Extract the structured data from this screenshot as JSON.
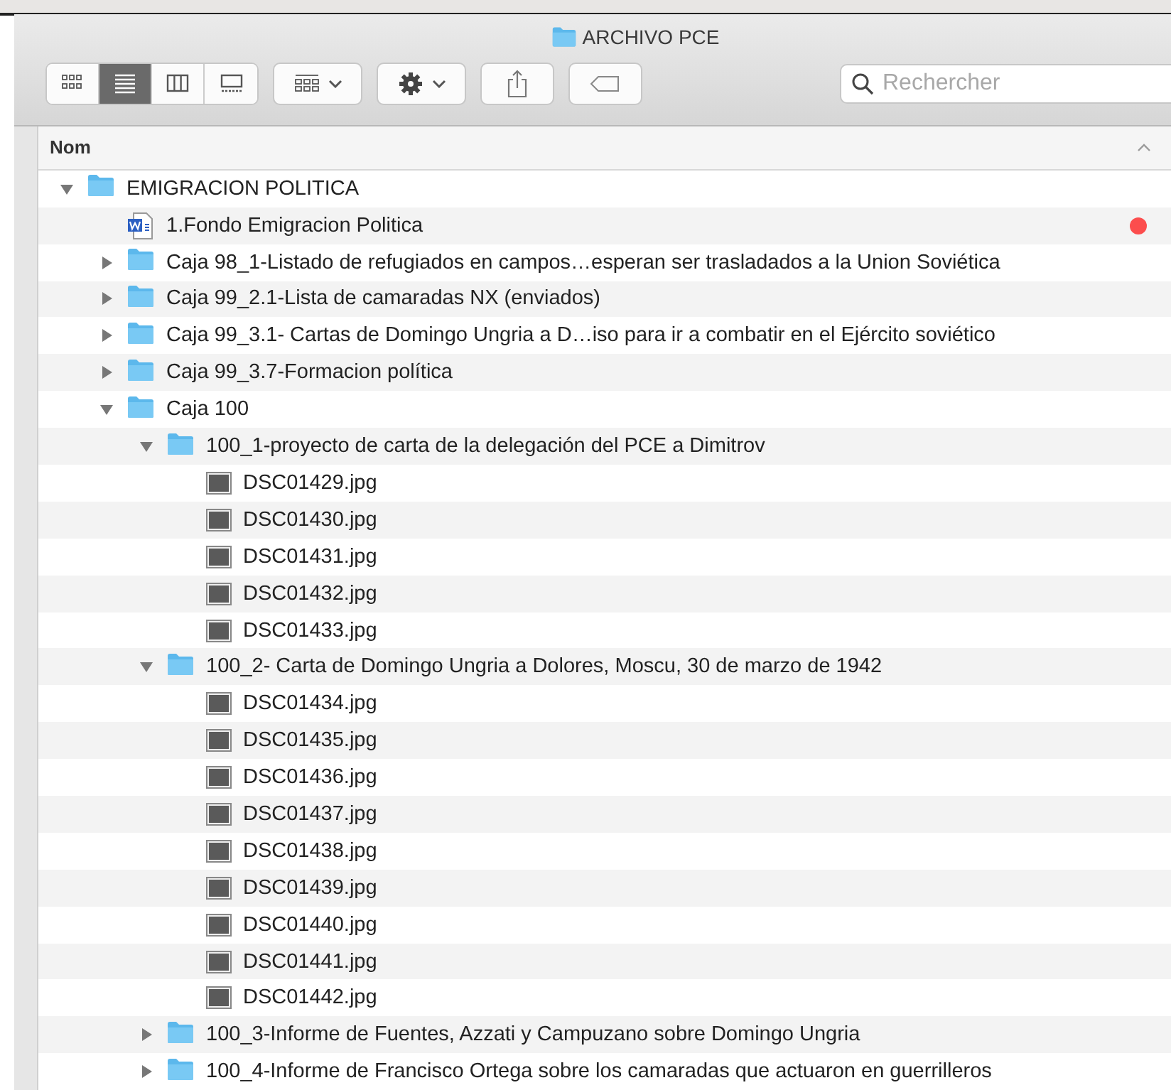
{
  "window": {
    "title": "ARCHIVO PCE"
  },
  "toolbar": {
    "view_modes": [
      {
        "kind": "icons",
        "selected": false
      },
      {
        "kind": "list",
        "selected": true
      },
      {
        "kind": "columns",
        "selected": false
      },
      {
        "kind": "gallery",
        "selected": false
      }
    ]
  },
  "search": {
    "placeholder": "Rechercher"
  },
  "table": {
    "columns": [
      "Nom"
    ],
    "rows": [
      {
        "kind": "folder",
        "name": "EMIGRACION POLITICA",
        "expanded": true,
        "children": [
          {
            "kind": "word",
            "name": "1.Fondo Emigracion Politica",
            "color": "#fc4d4d"
          },
          {
            "kind": "folder",
            "name": "Caja 98_1-Listado de refugiados en campos…esperan ser trasladados a la Union Soviética",
            "expanded": false
          },
          {
            "kind": "folder",
            "name": "Caja 99_2.1-Lista de camaradas NX (enviados)",
            "expanded": false
          },
          {
            "kind": "folder",
            "name": "Caja 99_3.1- Cartas de Domingo Ungria a D…iso para ir a combatir en el Ejército soviético",
            "expanded": false
          },
          {
            "kind": "folder",
            "name": "Caja 99_3.7-Formacion política",
            "expanded": false
          },
          {
            "kind": "folder",
            "name": "Caja 100",
            "expanded": true,
            "children": [
              {
                "kind": "folder",
                "name": "100_1-proyecto de carta de la delegación del PCE a Dimitrov",
                "expanded": true,
                "children": [
                  {
                    "kind": "image",
                    "name": "DSC01429.jpg"
                  },
                  {
                    "kind": "image",
                    "name": "DSC01430.jpg"
                  },
                  {
                    "kind": "image",
                    "name": "DSC01431.jpg"
                  },
                  {
                    "kind": "image",
                    "name": "DSC01432.jpg"
                  },
                  {
                    "kind": "image",
                    "name": "DSC01433.jpg"
                  }
                ]
              },
              {
                "kind": "folder",
                "name": "100_2- Carta de Domingo Ungria a Dolores, Moscu, 30 de marzo de 1942",
                "expanded": true,
                "children": [
                  {
                    "kind": "image",
                    "name": "DSC01434.jpg"
                  },
                  {
                    "kind": "image",
                    "name": "DSC01435.jpg"
                  },
                  {
                    "kind": "image",
                    "name": "DSC01436.jpg"
                  },
                  {
                    "kind": "image",
                    "name": "DSC01437.jpg"
                  },
                  {
                    "kind": "image",
                    "name": "DSC01438.jpg"
                  },
                  {
                    "kind": "image",
                    "name": "DSC01439.jpg"
                  },
                  {
                    "kind": "image",
                    "name": "DSC01440.jpg"
                  },
                  {
                    "kind": "image",
                    "name": "DSC01441.jpg"
                  },
                  {
                    "kind": "image",
                    "name": "DSC01442.jpg"
                  }
                ]
              },
              {
                "kind": "folder",
                "name": "100_3-Informe de Fuentes, Azzati y Campuzano sobre Domingo Ungria",
                "expanded": false
              },
              {
                "kind": "folder",
                "name": "100_4-Informe de Francisco Ortega sobre los camaradas que actuaron en guerrilleros",
                "expanded": false
              }
            ]
          }
        ]
      }
    ]
  }
}
